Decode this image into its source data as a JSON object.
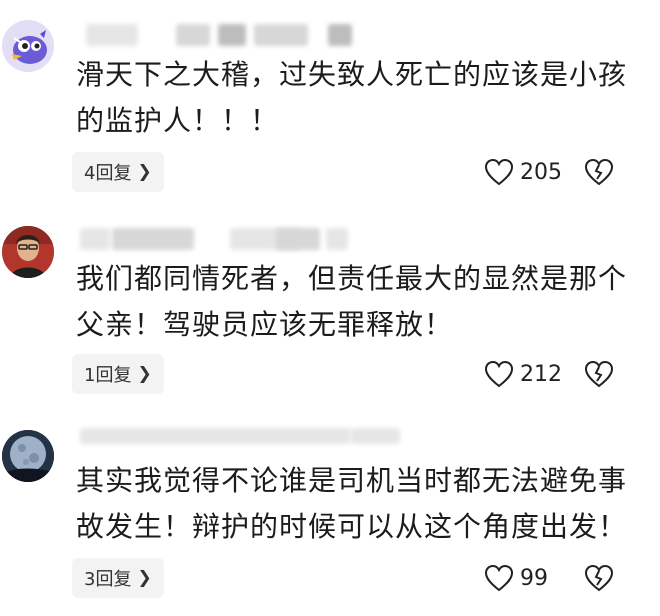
{
  "comments": [
    {
      "text_line1": "滑天下之大稽，过失致人死亡的应该是小孩",
      "text_line2": "的监护人！！！",
      "reply_label": "4回复",
      "like_count": "205",
      "avatar_icon": "cartoon-bird-icon"
    },
    {
      "text_line1": "我们都同情死者，但责任最大的显然是那个",
      "text_line2": "父亲！驾驶员应该无罪释放！",
      "reply_label": "1回复",
      "like_count": "212",
      "avatar_icon": "person-photo-icon"
    },
    {
      "text_line1": "其实我觉得不论谁是司机当时都无法避免事",
      "text_line2": "故发生！辩护的时候可以从这个角度出发！",
      "reply_label": "3回复",
      "like_count": "99",
      "avatar_icon": "moon-photo-icon"
    }
  ],
  "icons": {
    "like": "heart-outline-icon",
    "dislike": "broken-heart-icon",
    "chevron": "chevron-right-icon"
  },
  "colors": {
    "text": "#1c1c1c",
    "reply_bg": "#f3f3f3",
    "blurred_username": "#d7d7d7"
  }
}
